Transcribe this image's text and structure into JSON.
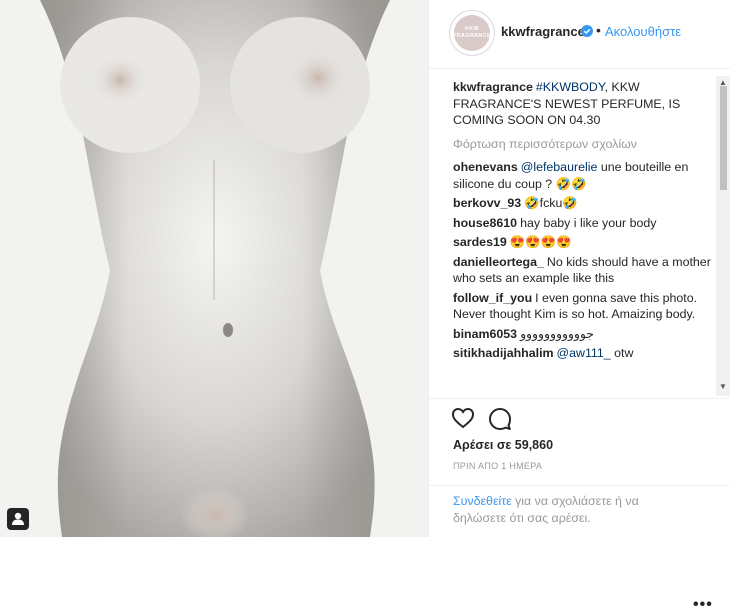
{
  "post": {
    "username": "kkwfragrance",
    "follow_label": "Ακολουθήστε",
    "avatar_text_1": "KKW",
    "avatar_text_2": "FRAGRANCE",
    "dot": "•",
    "caption_user": "kkwfragrance",
    "caption_hashtag": "#KKWBODY",
    "caption_text": ", KKW FRAGRANCE'S NEWEST PERFUME, IS COMING SOON ON 04.30",
    "load_more": "Φόρτωση περισσότερων σχολίων"
  },
  "comments": [
    {
      "user": "ohenevans",
      "mention": "@lefebaurelie",
      "text": " une bouteille en silicone du coup ? 🤣🤣"
    },
    {
      "user": "berkovv_93",
      "mention": "",
      "text": "🤣fcku🤣"
    },
    {
      "user": "house8610",
      "mention": "",
      "text": "hay baby i like your body"
    },
    {
      "user": "sardes19",
      "mention": "",
      "text": "😍😍😍😍"
    },
    {
      "user": "danielleortega_",
      "mention": "",
      "text": "No kids should have a mother who sets an example like this"
    },
    {
      "user": "follow_if_you",
      "mention": "",
      "text": "I even gonna save this photo. Never thought Kim is so hot. Amaizing body."
    },
    {
      "user": "binam6053",
      "mention": "",
      "text": "جووووووووووو"
    },
    {
      "user": "sitikhadijahhalim",
      "mention": "@aw111_",
      "text": " otw"
    }
  ],
  "actions": {
    "likes": "Αρέσει σε 59,860",
    "time": "ΠΡΙΝ ΑΠΟ 1 ΗΜΕΡΑ",
    "login_link": "Συνδεθείτε",
    "login_text": " για να σχολιάσετε ή να δηλώσετε ότι σας αρέσει.",
    "more": "•••"
  },
  "colors": {
    "link": "#3897f0",
    "mention": "#003569",
    "muted": "#999999",
    "verified": "#3897f0"
  }
}
